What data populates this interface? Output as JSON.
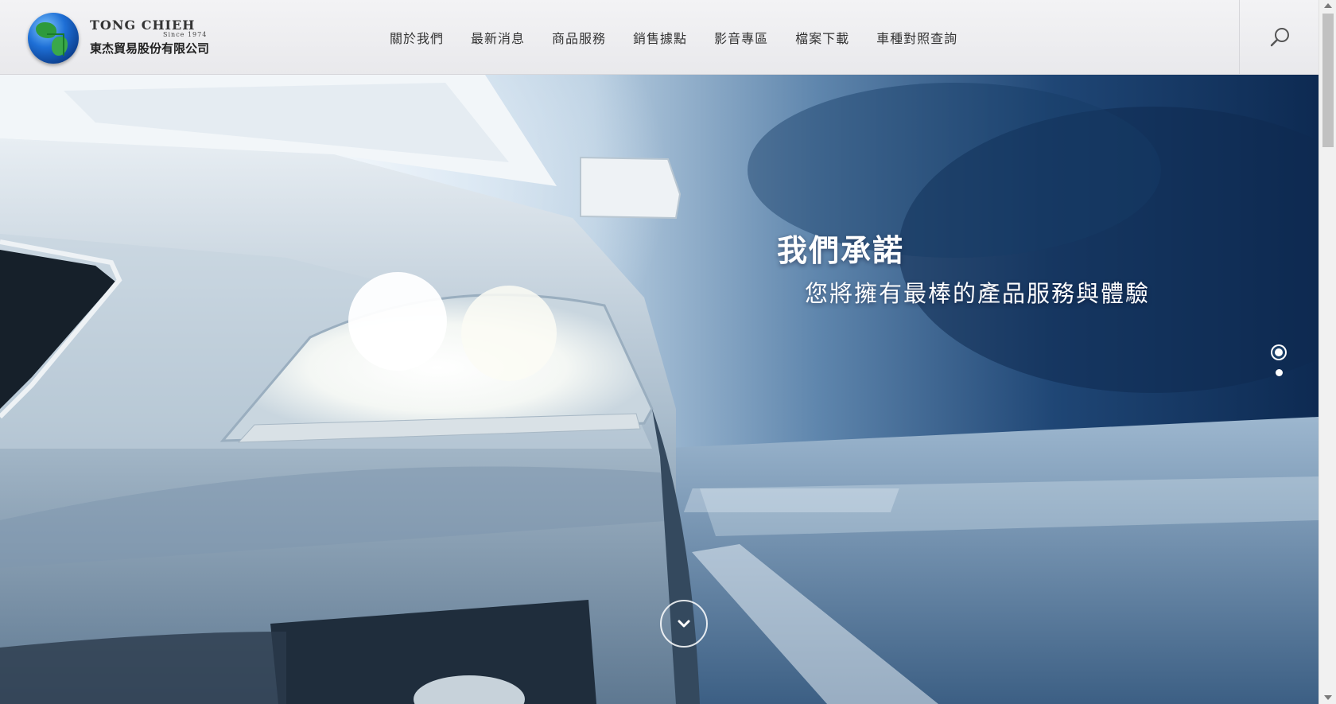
{
  "header": {
    "logo": {
      "name_en": "TONG CHIEH",
      "since": "Since 1974",
      "name_zh": "東杰貿易股份有限公司",
      "icon": "globe-logo-icon"
    },
    "nav": [
      {
        "label": "關於我們"
      },
      {
        "label": "最新消息"
      },
      {
        "label": "商品服務"
      },
      {
        "label": "銷售據點"
      },
      {
        "label": "影音專區"
      },
      {
        "label": "檔案下載"
      },
      {
        "label": "車種對照查詢"
      }
    ],
    "search_icon": "search-icon"
  },
  "hero": {
    "title": "我們承諾",
    "subtitle": "您將擁有最棒的產品服務與體驗",
    "slides_total": 2,
    "active_slide": 1,
    "scroll_icon": "chevron-down-icon"
  },
  "colors": {
    "header_bg": "#eeeef0",
    "hero_dark": "#0d2a52",
    "hero_light": "#cfe3f3",
    "text_nav": "#333333",
    "text_hero": "#ffffff"
  }
}
